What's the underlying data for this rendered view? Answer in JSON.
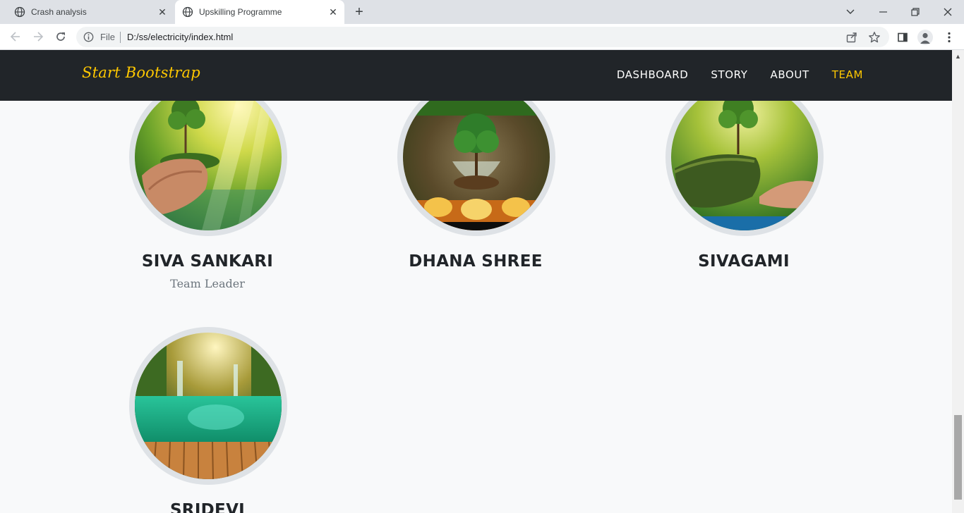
{
  "browser": {
    "tabs": [
      {
        "title": "Crash analysis",
        "active": false
      },
      {
        "title": "Upskilling Programme",
        "active": true
      }
    ],
    "address": {
      "scheme_label": "File",
      "url": "D:/ss/electricity/index.html"
    }
  },
  "navbar": {
    "brand": "Start Bootstrap",
    "links": [
      "DASHBOARD",
      "STORY",
      "ABOUT",
      "TEAM"
    ],
    "active_link": "TEAM"
  },
  "team": [
    {
      "name": "SIVA SANKARI",
      "role": "Team Leader",
      "photo": "tree-in-hands-sunlight-photo"
    },
    {
      "name": "DHANA SHREE",
      "role": "",
      "photo": "tree-in-globe-photo"
    },
    {
      "name": "SIVAGAMI",
      "role": "",
      "photo": "hands-holding-earth-tree-photo"
    },
    {
      "name": "SRIDEVI",
      "role": "",
      "photo": "waterfall-lagoon-photo"
    }
  ],
  "colors": {
    "accent": "#ffc800",
    "navbar_bg": "#212529",
    "page_bg": "#f8f9fa",
    "photo_border": "#dee2e6"
  }
}
